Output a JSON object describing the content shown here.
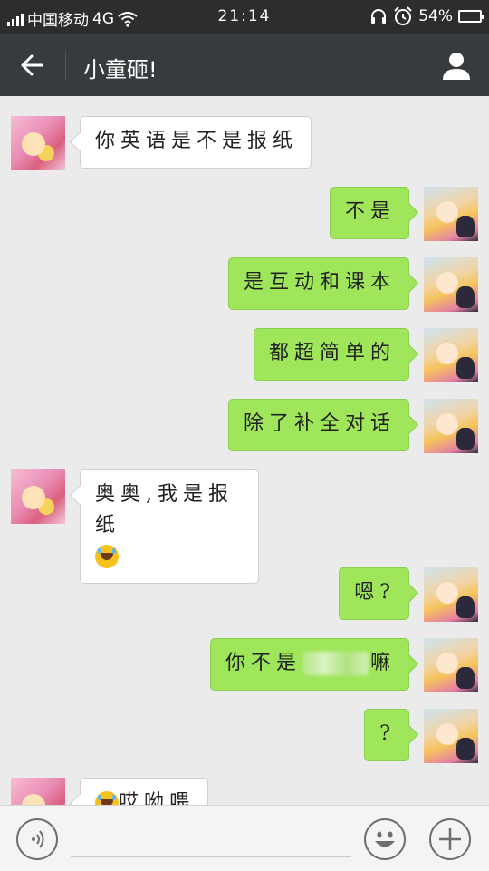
{
  "status_bar": {
    "carrier": "中国移动",
    "network": "4G",
    "time": "21:14",
    "battery": "54%",
    "battery_level": 0.54
  },
  "header": {
    "title": "小童砸!",
    "back_icon": "arrow-left-icon",
    "contact_icon": "person-icon"
  },
  "messages": [
    {
      "side": "left",
      "text": "你英语是不是报纸"
    },
    {
      "side": "right",
      "text": "不是"
    },
    {
      "side": "right",
      "text": "是互动和课本"
    },
    {
      "side": "right",
      "text": "都超简单的"
    },
    {
      "side": "right",
      "text": "除了补全对话"
    },
    {
      "side": "left",
      "text": "奥奥,我是报纸",
      "emoji": "tears-of-joy-emoji"
    },
    {
      "side": "right",
      "text": "嗯?"
    },
    {
      "side": "right",
      "text_before": "你不是",
      "text_after": "嘛"
    },
    {
      "side": "right",
      "text": "?"
    },
    {
      "side": "left",
      "emoji": "tears-of-joy-emoji",
      "text": "哎呦喂"
    }
  ],
  "input_bar": {
    "voice_icon": "voice-icon",
    "emoji_icon": "smiley-icon",
    "plus_icon": "plus-icon",
    "text_value": ""
  },
  "colors": {
    "outgoing_bubble": "#9fe65a",
    "incoming_bubble": "#ffffff",
    "background": "#ebebeb",
    "title_bar": "#373b3e"
  }
}
